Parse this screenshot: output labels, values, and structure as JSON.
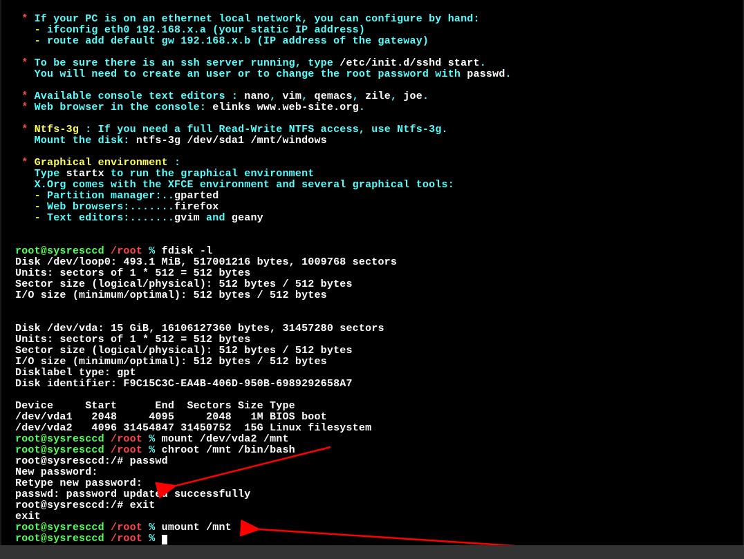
{
  "intro": {
    "l1a": " * ",
    "l1b": "If your PC is on an ethernet local network, you can configure by hand:",
    "l2a": "   - ",
    "l2b": "ifconfig eth0 192.168.x.a (your static IP address)",
    "l3a": "   - ",
    "l3b": "route add default gw 192.168.x.b (IP address of the gateway)",
    "l4a": " * ",
    "l4b": "To be sure there is an ssh server running, type ",
    "l4c": "/etc/init.d/sshd start",
    "l4d": ".",
    "l5a": "   You will need to create an user or to change the root password with ",
    "l5b": "passwd",
    "l5c": ".",
    "l6a": " * ",
    "l6b": "Available console text editors : ",
    "l6c": "nano",
    "l6d": ", ",
    "l6e": "vim",
    "l6f": ", ",
    "l6g": "qemacs",
    "l6h": ", ",
    "l6i": "zile",
    "l6j": ", ",
    "l6k": "joe",
    "l6l": ".",
    "l7a": " * ",
    "l7b": "Web browser in the console: ",
    "l7c": "elinks www.web-site.org",
    "l7d": ".",
    "l8a": " * ",
    "l8b": "Ntfs-3g",
    "l8c": " : If you need a full Read-Write NTFS access, use Ntfs-3g.",
    "l9a": "   Mount the disk: ",
    "l9b": "ntfs-3g /dev/sda1 /mnt/windows",
    "l10a": " * ",
    "l10b": "Graphical environment",
    "l10c": " :",
    "l11a": "   Type ",
    "l11b": "startx",
    "l11c": " to run the graphical environment",
    "l12": "   X.Org comes with the XFCE environment and several graphical tools:",
    "l13a": "   - ",
    "l13b": "Partition manager:..",
    "l13c": "gparted",
    "l14a": "   - ",
    "l14b": "Web browsers:.......",
    "l14c": "firefox",
    "l15a": "   - ",
    "l15b": "Text editors:.......",
    "l15c": "gvim",
    "l15d": " and ",
    "l15e": "geany"
  },
  "prompt": {
    "user": "root@sysresccd",
    "path": " /root",
    "sep": " % "
  },
  "cmd": {
    "fdisk": "fdisk -l",
    "mount": "mount /dev/vda2 /mnt",
    "chroot": "chroot /mnt /bin/bash",
    "umount": "umount /mnt"
  },
  "fdisk": {
    "d1": "Disk /dev/loop0: 493.1 MiB, 517001216 bytes, 1009768 sectors",
    "u1": "Units: sectors of 1 * 512 = 512 bytes",
    "s1": "Sector size (logical/physical): 512 bytes / 512 bytes",
    "io1": "I/O size (minimum/optimal): 512 bytes / 512 bytes",
    "d2": "Disk /dev/vda: 15 GiB, 16106127360 bytes, 31457280 sectors",
    "u2": "Units: sectors of 1 * 512 = 512 bytes",
    "s2": "Sector size (logical/physical): 512 bytes / 512 bytes",
    "io2": "I/O size (minimum/optimal): 512 bytes / 512 bytes",
    "lbl": "Disklabel type: gpt",
    "id": "Disk identifier: F9C15C3C-EA4B-406D-950B-6989292658A7",
    "hdr": "Device     Start      End  Sectors Size Type",
    "r1": "/dev/vda1   2048     4095     2048   1M BIOS boot",
    "r2": "/dev/vda2   4096 31454847 31450752  15G Linux filesystem"
  },
  "chroot": {
    "p1": "root@sysresccd:/# passwd",
    "np": "New password:",
    "rp": "Retype new password:",
    "ok": "passwd: password updated successfully",
    "ex": "root@sysresccd:/# exit",
    "exit": "exit"
  }
}
